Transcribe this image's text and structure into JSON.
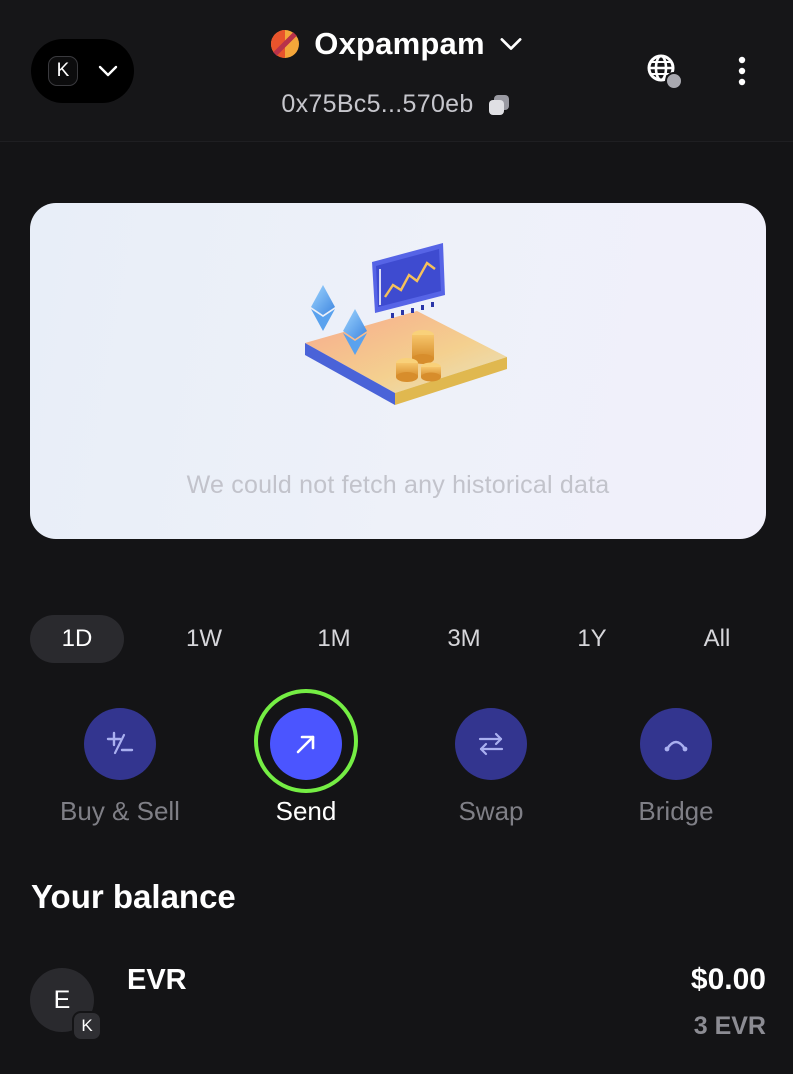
{
  "header": {
    "account_initial": "K",
    "wallet_name": "Oxpampam",
    "address": "0x75Bc5...570eb",
    "icons": {
      "account_chevron": "chevron-down-icon",
      "wallet_chevron": "chevron-down-icon",
      "copy": "copy-icon",
      "network": "globe-icon",
      "more": "more-vertical-icon"
    }
  },
  "chart": {
    "empty_message": "We could not fetch any historical data"
  },
  "periods": {
    "active": "1D",
    "items": [
      {
        "label": "1D"
      },
      {
        "label": "1W"
      },
      {
        "label": "1M"
      },
      {
        "label": "3M"
      },
      {
        "label": "1Y"
      },
      {
        "label": "All"
      }
    ]
  },
  "actions": [
    {
      "label": "Buy & Sell",
      "icon": "plus-minus-icon"
    },
    {
      "label": "Send",
      "icon": "arrow-up-right-icon"
    },
    {
      "label": "Swap",
      "icon": "swap-arrows-icon"
    },
    {
      "label": "Bridge",
      "icon": "bridge-icon"
    }
  ],
  "balance": {
    "title": "Your balance",
    "assets": [
      {
        "icon_letter": "E",
        "badge_letter": "K",
        "symbol": "EVR",
        "fiat_value": "$0.00",
        "amount": "3 EVR"
      }
    ]
  },
  "colors": {
    "background": "#141416",
    "accent": "#4b55ff",
    "action_circle": "#33358f",
    "highlight_ring": "#75ee44",
    "muted_text": "#7f7f86"
  }
}
